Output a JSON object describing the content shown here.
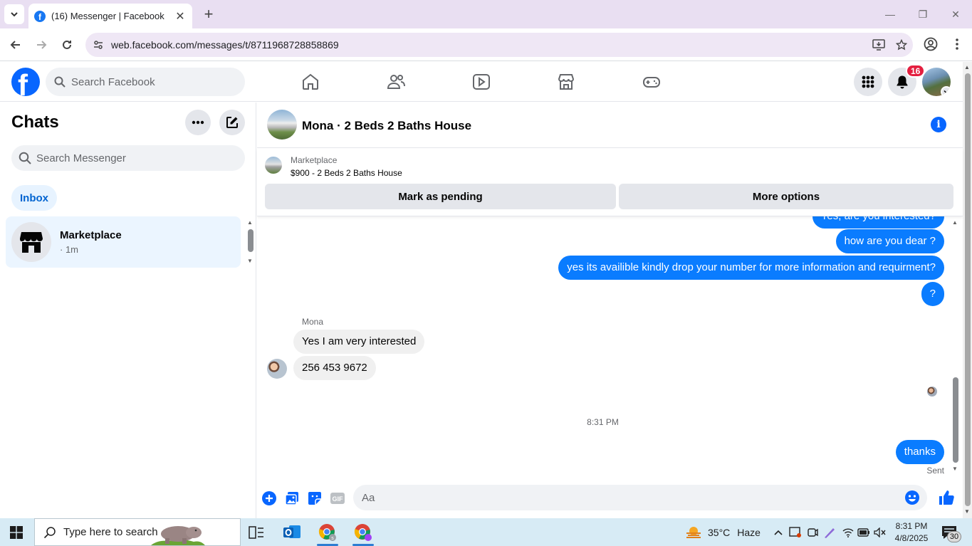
{
  "browser": {
    "tab_title": "(16) Messenger | Facebook",
    "url": "web.facebook.com/messages/t/8711968728858869"
  },
  "fb": {
    "search_placeholder": "Search Facebook",
    "notification_count": "16"
  },
  "chats": {
    "title": "Chats",
    "search_placeholder": "Search Messenger",
    "filter_label": "Inbox",
    "items": [
      {
        "name": "Marketplace",
        "time": "· 1m"
      }
    ]
  },
  "conversation": {
    "title": "Mona · 2 Beds 2 Baths House",
    "marketplace_label": "Marketplace",
    "listing": "$900 - 2 Beds 2 Baths House",
    "mark_pending_label": "Mark as pending",
    "more_options_label": "More options",
    "messages": [
      {
        "from": "me",
        "text": "Yes, are you interested?"
      },
      {
        "from": "me",
        "text": "how are you dear ?"
      },
      {
        "from": "me",
        "text": "yes its availible kindly drop your number for more information and requirment?"
      },
      {
        "from": "me",
        "text": "?"
      },
      {
        "from": "Mona",
        "text": "Yes I am very interested"
      },
      {
        "from": "Mona",
        "text": "256 453 9672"
      },
      {
        "from": "me",
        "text": "thanks"
      }
    ],
    "sender_name": "Mona",
    "timestamp": "8:31 PM",
    "sent_status": "Sent",
    "composer_placeholder": "Aa"
  },
  "taskbar": {
    "search_placeholder": "Type here to search",
    "temperature": "35°C",
    "weather": "Haze",
    "time": "8:31 PM",
    "date": "4/8/2025",
    "notification_count": "30"
  },
  "colors": {
    "fb_blue": "#0866ff",
    "bubble_out": "#0a7cff",
    "bubble_in": "#f0f0f0",
    "badge_red": "#e41e3f"
  }
}
